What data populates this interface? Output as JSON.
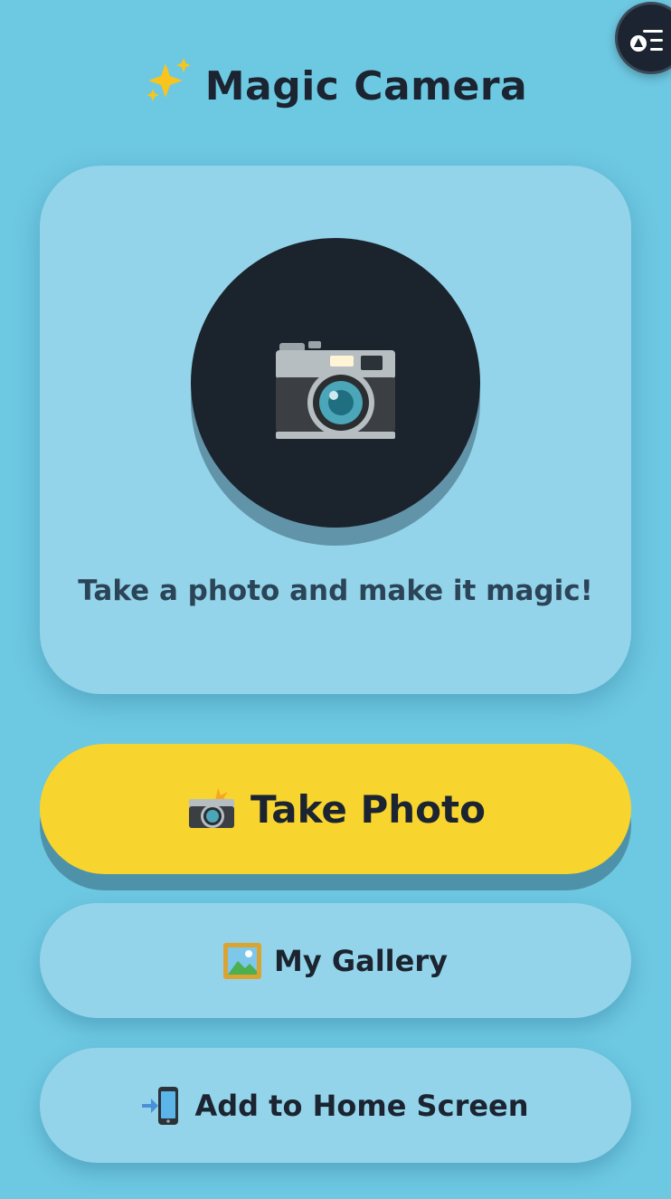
{
  "header": {
    "title": "Magic Camera",
    "title_icon": "sparkles-icon"
  },
  "menu_button": {
    "icon": "menu-icon"
  },
  "camera_card": {
    "icon": "camera-icon",
    "tagline": "Take a photo and make it magic!"
  },
  "actions": {
    "take_photo_label": "Take Photo",
    "take_photo_icon": "camera-flash-icon",
    "gallery_label": "My Gallery",
    "gallery_icon": "framed-picture-icon",
    "home_screen_label": "Add to Home Screen",
    "home_screen_icon": "phone-arrow-icon"
  },
  "colors": {
    "background": "#6dc8e2",
    "card": "#93d4ea",
    "primary_button": "#f8d42e",
    "text": "#1b2430",
    "camera_circle": "#1b232d"
  }
}
